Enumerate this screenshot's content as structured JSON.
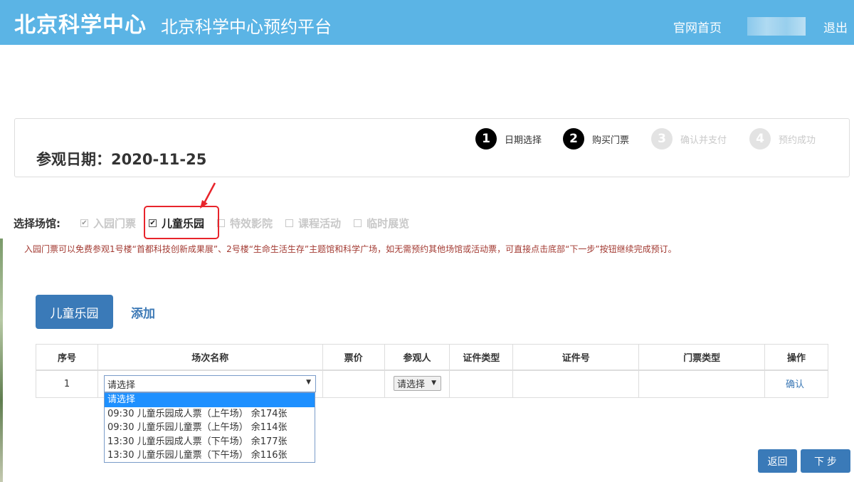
{
  "header": {
    "logo": "北京科学中心",
    "title": "北京科学中心预约平台",
    "home_link": "官网首页",
    "logout": "退出"
  },
  "date_panel": {
    "visit_date": "参观日期：2020-11-25",
    "steps": [
      {
        "num": "1",
        "label": "日期选择",
        "state": "done"
      },
      {
        "num": "2",
        "label": "购买门票",
        "state": "current"
      },
      {
        "num": "3",
        "label": "确认并支付",
        "state": "todo"
      },
      {
        "num": "4",
        "label": "预约成功",
        "state": "todo"
      }
    ]
  },
  "venues": {
    "label": "选择场馆:",
    "options": [
      {
        "label": "入园门票",
        "checked": true,
        "enabled": false
      },
      {
        "label": "儿童乐园",
        "checked": true,
        "enabled": true
      },
      {
        "label": "特效影院",
        "checked": false,
        "enabled": false
      },
      {
        "label": "课程活动",
        "checked": false,
        "enabled": false
      },
      {
        "label": "临时展览",
        "checked": false,
        "enabled": false
      }
    ],
    "highlight_color": "#e8242b"
  },
  "notice": "入园门票可以免费参观1号楼“首都科技创新成果展”、2号楼“生命生活生存”主题馆和科学广场，如无需预约其他场馆或活动票，可直接点击底部“下一步”按钮继续完成预订。",
  "tabs": {
    "active": "儿童乐园",
    "add": "添加"
  },
  "table": {
    "columns": [
      "序号",
      "场次名称",
      "票价",
      "参观人",
      "证件类型",
      "证件号",
      "门票类型",
      "操作"
    ],
    "row": {
      "index": "1",
      "session_value": "请选择",
      "visitor_value": "请选择",
      "action": "确认"
    }
  },
  "session_dropdown": {
    "options": [
      "请选择",
      "09:30 儿童乐园成人票（上午场） 余174张",
      "09:30 儿童乐园儿童票（上午场） 余114张",
      "13:30 儿童乐园成人票（下午场） 余177张",
      "13:30 儿童乐园儿童票（下午场） 余116张"
    ],
    "highlighted_index": 0
  },
  "buttons": {
    "back": "返回",
    "next": "下 步"
  },
  "colors": {
    "header_bg": "#5bb4e5",
    "primary": "#3a7ab8",
    "notice": "#a33b33"
  }
}
